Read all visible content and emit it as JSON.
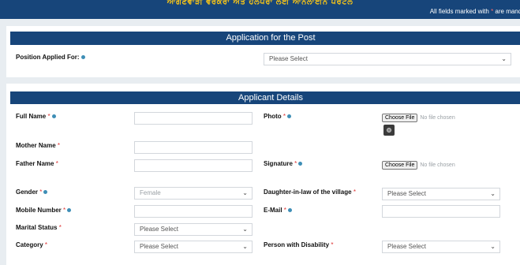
{
  "header": {
    "title": "ਆਂਗਣਵਾੜੀ ਵਰਕਰਾਂ ਅਤੇ ਹੈਲਪਰਾਂ ਲਈ ਆਨਲਾਈਨ ਪੋਰਟਲ",
    "mandate_prefix": "All fields marked with ",
    "mandate_star": "*",
    "mandate_suffix": " are mandatory"
  },
  "application": {
    "heading": "Application for the Post",
    "position_label": "Position Applied For:",
    "position_value": "Please Select"
  },
  "applicant": {
    "heading": "Applicant Details",
    "full_name_label": "Full Name",
    "photo_label": "Photo",
    "photo_button": "Choose File",
    "photo_status": "No file chosen",
    "mother_name_label": "Mother Name",
    "father_name_label": "Father Name",
    "signature_label": "Signature",
    "signature_button": "Choose File",
    "signature_status": "No file chosen",
    "gender_label": "Gender",
    "gender_value": "Female",
    "daughter_label": "Daughter-in-law of the village",
    "daughter_value": "Please Select",
    "mobile_label": "Mobile Number",
    "email_label": "E-Mail",
    "marital_label": "Marital Status",
    "marital_value": "Please Select",
    "category_label": "Category",
    "category_value": "Please Select",
    "disability_label": "Person with Disability",
    "disability_value": "Please Select"
  },
  "required_star": "*",
  "colors": {
    "header_bg": "#17457a",
    "title_color": "#f2c21a",
    "required": "#d33",
    "info_icon": "#3e8eb6"
  }
}
